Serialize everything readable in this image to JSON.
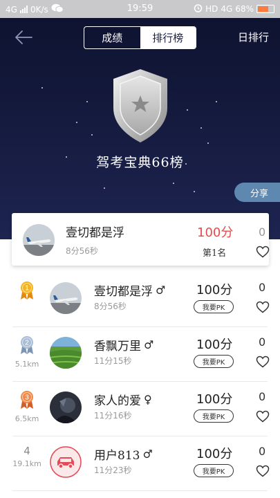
{
  "status_bar": {
    "network": "4G",
    "speed": "0K/s",
    "time": "19:59",
    "hd": "HD",
    "network2": "4G",
    "battery": "68%",
    "battery_level": 0.68
  },
  "header": {
    "tabs": [
      {
        "label": "成绩",
        "selected": false
      },
      {
        "label": "排行榜",
        "selected": true
      }
    ],
    "daily_label": "日排行",
    "board_title": "驾考宝典66榜",
    "share_label": "分享"
  },
  "my_entry": {
    "name": "壹切都是浮",
    "time": "8分56秒",
    "score": "100分",
    "rank": "第1名",
    "likes": "0"
  },
  "ranking": [
    {
      "rank": "1",
      "medal": "gold",
      "distance": "",
      "name": "壹切都是浮",
      "gender": "♂",
      "time": "8分56秒",
      "score": "100分",
      "pk_label": "我要PK",
      "likes": "0",
      "avatar": "airplane"
    },
    {
      "rank": "2",
      "medal": "silver",
      "distance": "5.1km",
      "name": "香飘万里",
      "gender": "♂",
      "time": "11分15秒",
      "score": "100分",
      "pk_label": "我要PK",
      "likes": "0",
      "avatar": "field"
    },
    {
      "rank": "3",
      "medal": "bronze",
      "distance": "6.5km",
      "name": "家人的爱",
      "gender": "♀",
      "time": "11分16秒",
      "score": "100分",
      "pk_label": "我要PK",
      "likes": "0",
      "avatar": "dark"
    },
    {
      "rank": "4",
      "medal": "",
      "distance": "19.1km",
      "name": "用户813",
      "gender": "♂",
      "time": "11分23秒",
      "score": "100分",
      "pk_label": "我要PK",
      "likes": "0",
      "avatar": "car"
    }
  ],
  "colors": {
    "header_bg": "#171d43",
    "score_highlight": "#e84a4a",
    "share_bg": "#5e88b0",
    "male": "#888888",
    "female": "#888888"
  }
}
